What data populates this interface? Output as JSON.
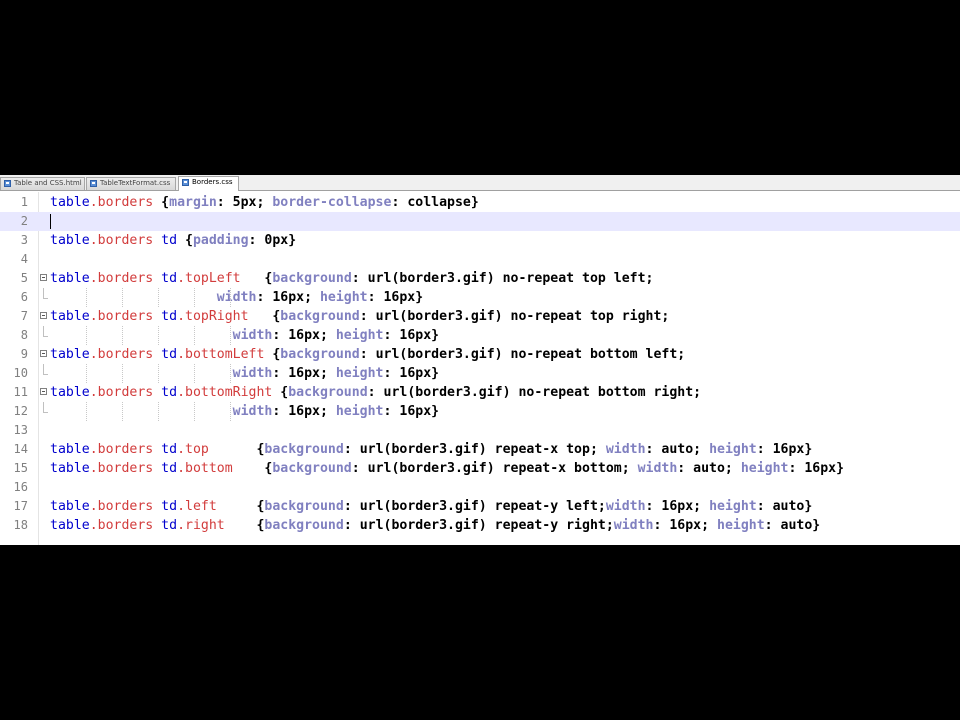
{
  "tabs": [
    {
      "label": "Table and CSS.html",
      "active": false
    },
    {
      "label": "TableTextFormat.css",
      "active": false
    },
    {
      "label": "Borders.css",
      "active": true
    }
  ],
  "current_line": 2,
  "lines": [
    {
      "num": "1",
      "tokens": [
        [
          "sel",
          "table"
        ],
        [
          "cls",
          ".borders"
        ],
        [
          "pun",
          " {"
        ],
        [
          "prop",
          "margin"
        ],
        [
          "val",
          ": 5px; "
        ],
        [
          "prop",
          "border-collapse"
        ],
        [
          "val",
          ": collapse"
        ],
        [
          "pun",
          "}"
        ]
      ]
    },
    {
      "num": "2",
      "tokens": []
    },
    {
      "num": "3",
      "tokens": [
        [
          "sel",
          "table"
        ],
        [
          "cls",
          ".borders"
        ],
        [
          "sel",
          " td"
        ],
        [
          "pun",
          " {"
        ],
        [
          "prop",
          "padding"
        ],
        [
          "val",
          ": 0px"
        ],
        [
          "pun",
          "}"
        ]
      ]
    },
    {
      "num": "4",
      "tokens": []
    },
    {
      "num": "5",
      "tokens": [
        [
          "sel",
          "table"
        ],
        [
          "cls",
          ".borders"
        ],
        [
          "sel",
          " td"
        ],
        [
          "cls",
          ".topLeft"
        ],
        [
          "pun",
          "   {"
        ],
        [
          "prop",
          "background"
        ],
        [
          "val",
          ": url(border3.gif) no-repeat top left;"
        ]
      ]
    },
    {
      "num": "6",
      "tokens": [
        [
          "val",
          "                     "
        ],
        [
          "prop",
          "width"
        ],
        [
          "val",
          ": 16px; "
        ],
        [
          "prop",
          "height"
        ],
        [
          "val",
          ": 16px"
        ],
        [
          "pun",
          "}"
        ]
      ]
    },
    {
      "num": "7",
      "tokens": [
        [
          "sel",
          "table"
        ],
        [
          "cls",
          ".borders"
        ],
        [
          "sel",
          " td"
        ],
        [
          "cls",
          ".topRight"
        ],
        [
          "pun",
          "   {"
        ],
        [
          "prop",
          "background"
        ],
        [
          "val",
          ": url(border3.gif) no-repeat top right;"
        ]
      ]
    },
    {
      "num": "8",
      "tokens": [
        [
          "val",
          "                       "
        ],
        [
          "prop",
          "width"
        ],
        [
          "val",
          ": 16px; "
        ],
        [
          "prop",
          "height"
        ],
        [
          "val",
          ": 16px"
        ],
        [
          "pun",
          "}"
        ]
      ]
    },
    {
      "num": "9",
      "tokens": [
        [
          "sel",
          "table"
        ],
        [
          "cls",
          ".borders"
        ],
        [
          "sel",
          " td"
        ],
        [
          "cls",
          ".bottomLeft"
        ],
        [
          "pun",
          " {"
        ],
        [
          "prop",
          "background"
        ],
        [
          "val",
          ": url(border3.gif) no-repeat bottom left;"
        ]
      ]
    },
    {
      "num": "10",
      "tokens": [
        [
          "val",
          "                       "
        ],
        [
          "prop",
          "width"
        ],
        [
          "val",
          ": 16px; "
        ],
        [
          "prop",
          "height"
        ],
        [
          "val",
          ": 16px"
        ],
        [
          "pun",
          "}"
        ]
      ]
    },
    {
      "num": "11",
      "tokens": [
        [
          "sel",
          "table"
        ],
        [
          "cls",
          ".borders"
        ],
        [
          "sel",
          " td"
        ],
        [
          "cls",
          ".bottomRight"
        ],
        [
          "pun",
          " {"
        ],
        [
          "prop",
          "background"
        ],
        [
          "val",
          ": url(border3.gif) no-repeat bottom right;"
        ]
      ]
    },
    {
      "num": "12",
      "tokens": [
        [
          "val",
          "                       "
        ],
        [
          "prop",
          "width"
        ],
        [
          "val",
          ": 16px; "
        ],
        [
          "prop",
          "height"
        ],
        [
          "val",
          ": 16px"
        ],
        [
          "pun",
          "}"
        ]
      ]
    },
    {
      "num": "13",
      "tokens": []
    },
    {
      "num": "14",
      "tokens": [
        [
          "sel",
          "table"
        ],
        [
          "cls",
          ".borders"
        ],
        [
          "sel",
          " td"
        ],
        [
          "cls",
          ".top"
        ],
        [
          "pun",
          "      {"
        ],
        [
          "prop",
          "background"
        ],
        [
          "val",
          ": url(border3.gif) repeat-x top; "
        ],
        [
          "prop",
          "width"
        ],
        [
          "val",
          ": auto; "
        ],
        [
          "prop",
          "height"
        ],
        [
          "val",
          ": 16px"
        ],
        [
          "pun",
          "}"
        ]
      ]
    },
    {
      "num": "15",
      "tokens": [
        [
          "sel",
          "table"
        ],
        [
          "cls",
          ".borders"
        ],
        [
          "sel",
          " td"
        ],
        [
          "cls",
          ".bottom"
        ],
        [
          "pun",
          "    {"
        ],
        [
          "prop",
          "background"
        ],
        [
          "val",
          ": url(border3.gif) repeat-x bottom; "
        ],
        [
          "prop",
          "width"
        ],
        [
          "val",
          ": auto; "
        ],
        [
          "prop",
          "height"
        ],
        [
          "val",
          ": 16px"
        ],
        [
          "pun",
          "}"
        ]
      ]
    },
    {
      "num": "16",
      "tokens": []
    },
    {
      "num": "17",
      "tokens": [
        [
          "sel",
          "table"
        ],
        [
          "cls",
          ".borders"
        ],
        [
          "sel",
          " td"
        ],
        [
          "cls",
          ".left"
        ],
        [
          "pun",
          "     {"
        ],
        [
          "prop",
          "background"
        ],
        [
          "val",
          ": url(border3.gif) repeat-y left;"
        ],
        [
          "prop",
          "width"
        ],
        [
          "val",
          ": 16px; "
        ],
        [
          "prop",
          "height"
        ],
        [
          "val",
          ": auto"
        ],
        [
          "pun",
          "}"
        ]
      ]
    },
    {
      "num": "18",
      "tokens": [
        [
          "sel",
          "table"
        ],
        [
          "cls",
          ".borders"
        ],
        [
          "sel",
          " td"
        ],
        [
          "cls",
          ".right"
        ],
        [
          "pun",
          "    {"
        ],
        [
          "prop",
          "background"
        ],
        [
          "val",
          ": url(border3.gif) repeat-y right;"
        ],
        [
          "prop",
          "width"
        ],
        [
          "val",
          ": 16px; "
        ],
        [
          "prop",
          "height"
        ],
        [
          "val",
          ": auto"
        ],
        [
          "pun",
          "}"
        ]
      ]
    }
  ]
}
